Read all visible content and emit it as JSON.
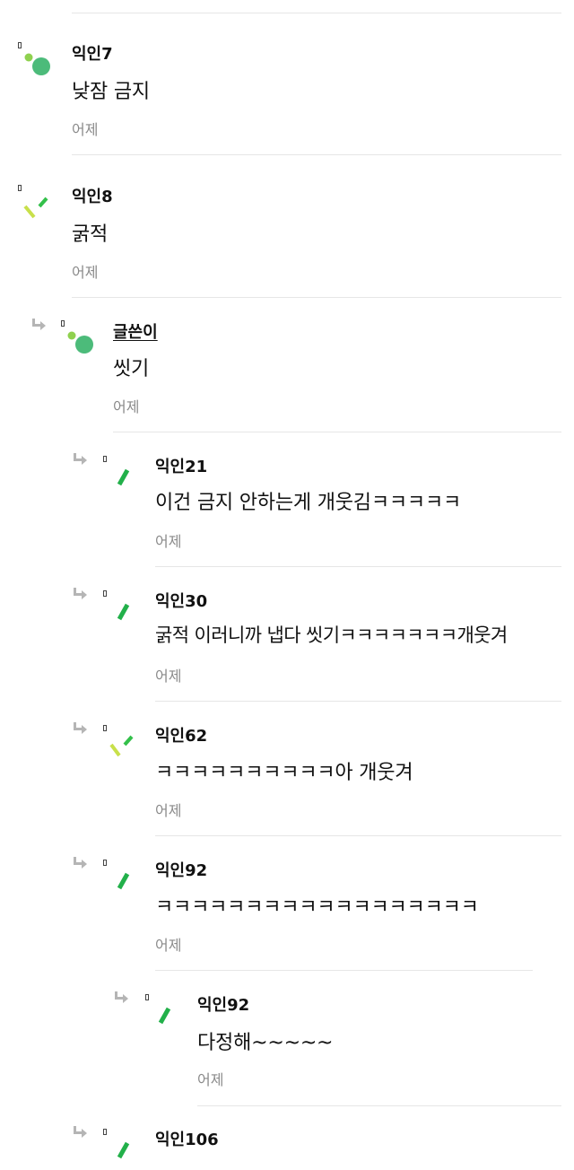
{
  "colors": {
    "author": "#111111",
    "body": "#111111",
    "time": "#8a8a8a",
    "divider": "#e6e6e6",
    "reply_arrow": "#b5b5b5"
  },
  "comments": [
    {
      "author": "익인7",
      "text": "낮잠 금지",
      "time": "어제",
      "avatar": "dots-avatar-icon"
    },
    {
      "author": "익인8",
      "text": "굵적",
      "time": "어제",
      "avatar": "slash-avatar-icon"
    },
    {
      "author": "글쓴이",
      "text": "씻기",
      "time": "어제",
      "avatar": "dots-avatar-icon",
      "is_writer": true
    },
    {
      "author": "익인21",
      "text": "이건 금지 안하는게 개웃김ㅋㅋㅋㅋㅋ",
      "time": "어제",
      "avatar": "bar-avatar-icon"
    },
    {
      "author": "익인30",
      "text": "굵적 이러니까 냅다 씻기ㅋㅋㅋㅋㅋㅋㅋ개웃겨",
      "time": "어제",
      "avatar": "bar-avatar-icon"
    },
    {
      "author": "익인62",
      "text": "ㅋㅋㅋㅋㅋㅋㅋㅋㅋㅋ아 개웃겨",
      "time": "어제",
      "avatar": "slash-avatar-icon"
    },
    {
      "author": "익인92",
      "text": "ㅋㅋㅋㅋㅋㅋㅋㅋㅋㅋㅋㅋㅋㅋㅋㅋㅋㅋ",
      "time": "어제",
      "avatar": "bar-avatar-icon"
    },
    {
      "author": "익인92",
      "text": "다정해~~~~~",
      "time": "어제",
      "avatar": "bar-avatar-icon"
    },
    {
      "author": "익인106",
      "text": "",
      "time": "",
      "avatar": "bar-avatar-icon"
    }
  ]
}
